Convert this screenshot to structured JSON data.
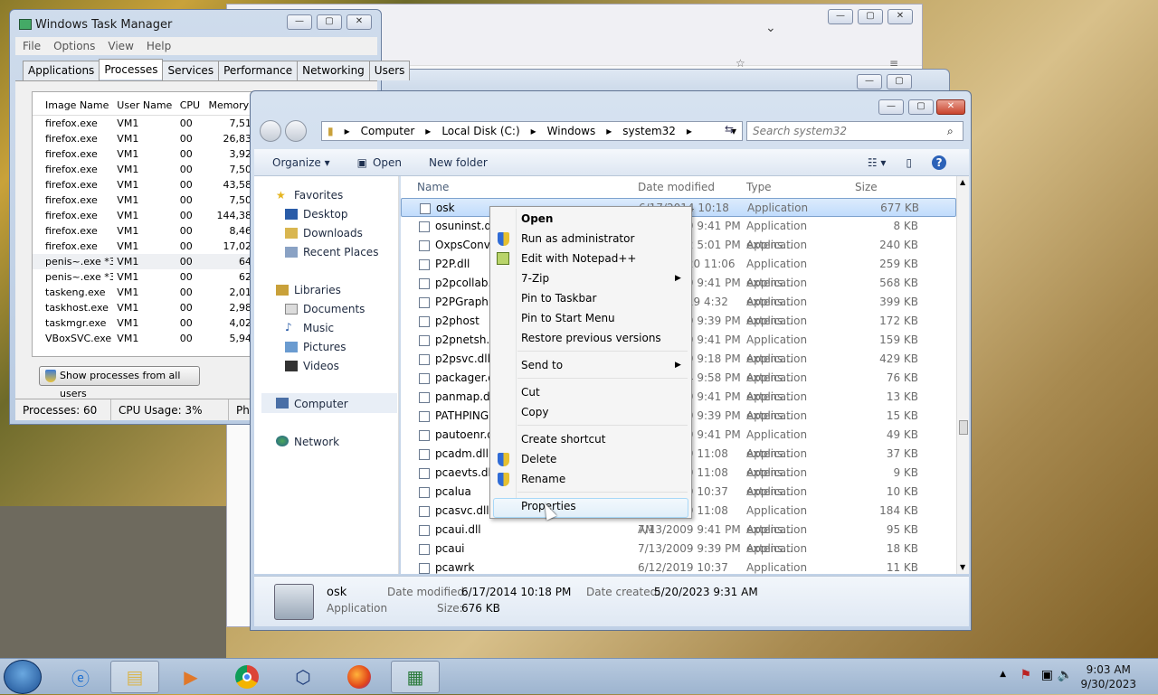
{
  "task_manager": {
    "title": "Windows Task Manager",
    "menu": [
      "File",
      "Options",
      "View",
      "Help"
    ],
    "tabs": [
      "Applications",
      "Processes",
      "Services",
      "Performance",
      "Networking",
      "Users"
    ],
    "columns": [
      "Image Name",
      "User Name",
      "CPU",
      "Memory"
    ],
    "rows": [
      [
        "firefox.exe",
        "VM1",
        "00",
        "7,51"
      ],
      [
        "firefox.exe",
        "VM1",
        "00",
        "26,83"
      ],
      [
        "firefox.exe",
        "VM1",
        "00",
        "3,92"
      ],
      [
        "firefox.exe",
        "VM1",
        "00",
        "7,50"
      ],
      [
        "firefox.exe",
        "VM1",
        "00",
        "43,58"
      ],
      [
        "firefox.exe",
        "VM1",
        "00",
        "7,50"
      ],
      [
        "firefox.exe",
        "VM1",
        "00",
        "144,38"
      ],
      [
        "firefox.exe",
        "VM1",
        "00",
        "8,46"
      ],
      [
        "firefox.exe",
        "VM1",
        "00",
        "17,02"
      ],
      [
        "penis~.exe *32",
        "VM1",
        "00",
        "64"
      ],
      [
        "penis~.exe *32",
        "VM1",
        "00",
        "62"
      ],
      [
        "taskeng.exe",
        "VM1",
        "00",
        "2,01"
      ],
      [
        "taskhost.exe",
        "VM1",
        "00",
        "2,98"
      ],
      [
        "taskmgr.exe",
        "VM1",
        "00",
        "4,02"
      ],
      [
        "VBoxSVC.exe",
        "VM1",
        "00",
        "5,94"
      ]
    ],
    "show_all_label": "Show processes from all users",
    "status": {
      "processes": "Processes: 60",
      "cpu": "CPU Usage: 3%",
      "phys": "Phy"
    }
  },
  "explorer": {
    "breadcrumb": [
      "Computer",
      "Local Disk (C:)",
      "Windows",
      "system32"
    ],
    "search_placeholder": "Search system32",
    "toolbar": {
      "organize": "Organize ▾",
      "open": "Open",
      "new_folder": "New folder"
    },
    "nav": {
      "favorites": "Favorites",
      "desktop": "Desktop",
      "downloads": "Downloads",
      "recent": "Recent Places",
      "libraries": "Libraries",
      "documents": "Documents",
      "music": "Music",
      "pictures": "Pictures",
      "videos": "Videos",
      "computer": "Computer",
      "network": "Network"
    },
    "columns": [
      "Name",
      "Date modified",
      "Type",
      "Size"
    ],
    "files": [
      [
        "osk",
        "6/17/2014 10:18 PM",
        "Application",
        "677 KB"
      ],
      [
        "osuninst.dll",
        "7/13/2009 9:41 PM",
        "Application extens...",
        "8 KB"
      ],
      [
        "OxpsConverter",
        "7/13/2012 5:01 PM",
        "Application",
        "240 KB"
      ],
      [
        "P2P.dll",
        "11/20/2020 11:06 PM",
        "Application extens...",
        "259 KB"
      ],
      [
        "p2pcollab.dll",
        "7/13/2009 9:41 PM",
        "Application extens...",
        "568 KB"
      ],
      [
        "P2PGraph.dll",
        "12/19/2019 4:32 AM",
        "Application extens...",
        "399 KB"
      ],
      [
        "p2phost",
        "7/13/2009 9:39 PM",
        "Application",
        "172 KB"
      ],
      [
        "p2pnetsh.dll",
        "7/13/2009 9:41 PM",
        "Application extens...",
        "159 KB"
      ],
      [
        "p2psvc.dll",
        "1/17/2019 9:18 PM",
        "Application extens...",
        "429 KB"
      ],
      [
        "packager.dll",
        "1/14/2014 9:58 PM",
        "Application extens...",
        "76 KB"
      ],
      [
        "panmap.dll",
        "7/13/2009 9:41 PM",
        "Application extens...",
        "13 KB"
      ],
      [
        "PATHPING",
        "7/13/2009 9:39 PM",
        "Application",
        "15 KB"
      ],
      [
        "pautoenr.dll",
        "7/13/2009 9:41 PM",
        "Application extens...",
        "49 KB"
      ],
      [
        "pcadm.dll",
        "6/12/2019 11:08 AM",
        "Application extens...",
        "37 KB"
      ],
      [
        "pcaevts.dll",
        "6/12/2019 11:08 AM",
        "Application extens...",
        "9 KB"
      ],
      [
        "pcalua",
        "6/12/2019 10:37 AM",
        "Application",
        "10 KB"
      ],
      [
        "pcasvc.dll",
        "6/12/2019 11:08 AM",
        "Application extens...",
        "184 KB"
      ],
      [
        "pcaui.dll",
        "7/13/2009 9:41 PM",
        "Application extens...",
        "95 KB"
      ],
      [
        "pcaui",
        "7/13/2009 9:39 PM",
        "Application",
        "18 KB"
      ],
      [
        "pcawrk",
        "6/12/2019 10:37 AM",
        "Application",
        "11 KB"
      ]
    ],
    "details": {
      "name": "osk",
      "type": "Application",
      "date_modified_label": "Date modified:",
      "date_modified": "6/17/2014 10:18 PM",
      "date_created_label": "Date created:",
      "date_created": "5/20/2023 9:31 AM",
      "size_label": "Size:",
      "size": "676 KB"
    }
  },
  "context_menu": {
    "open": "Open",
    "run_admin": "Run as administrator",
    "edit_npp": "Edit with Notepad++",
    "zip": "7-Zip",
    "pin_taskbar": "Pin to Taskbar",
    "pin_start": "Pin to Start Menu",
    "restore": "Restore previous versions",
    "send_to": "Send to",
    "cut": "Cut",
    "copy": "Copy",
    "create_shortcut": "Create shortcut",
    "delete": "Delete",
    "rename": "Rename",
    "properties": "Properties"
  },
  "taskbar": {
    "time": "9:03 AM",
    "date": "9/30/2023"
  },
  "colors": {
    "selection": "#c1dcfc",
    "taskbar": "#9db4cf"
  }
}
